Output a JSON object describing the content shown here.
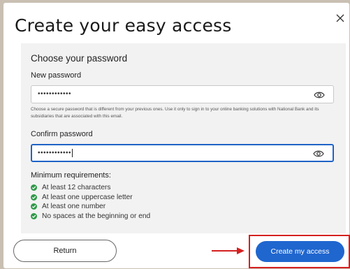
{
  "dialog": {
    "title": "Create your easy access",
    "close_icon": "close-icon"
  },
  "form": {
    "section_title": "Choose your password",
    "new_password": {
      "label": "New password",
      "value": "••••••••••••",
      "toggle_icon": "eye-icon"
    },
    "help_text": "Choose a secure password that is different from your previous ones. Use it only to sign in to your online banking solutions with National Bank and its subsidiaries that are associated with this email.",
    "confirm_password": {
      "label": "Confirm password",
      "value": "••••••••••••",
      "toggle_icon": "eye-icon"
    },
    "requirements": {
      "title": "Minimum requirements:",
      "items": [
        "At least 12 characters",
        "At least one uppercase letter",
        "At least one number",
        "No spaces at the beginning or end"
      ],
      "status_icon": "check-circle-icon",
      "status_color": "#2f9a48"
    }
  },
  "footer": {
    "return_label": "Return",
    "create_label": "Create my access",
    "primary_color": "#1f66cf",
    "annotation_color": "#d42020"
  }
}
